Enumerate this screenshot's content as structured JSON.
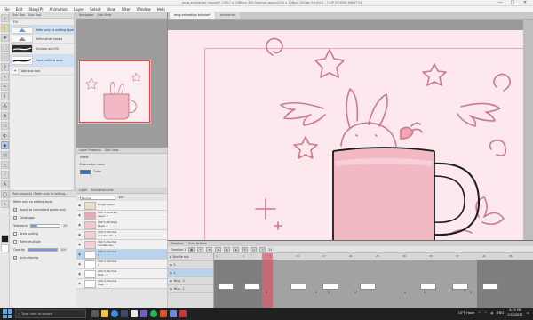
{
  "window": {
    "title": "mug animation tutorial* (1957 x 1080px 300 Normal space(204 x 128px 150dpi 98.4%)) - CLIP STUDIO PAINT EX",
    "controls": [
      "—",
      "□",
      "✕"
    ]
  },
  "menu": [
    "File",
    "Edit",
    "Story(P)",
    "Animation",
    "Layer",
    "Select",
    "View",
    "Filter",
    "Window",
    "Help"
  ],
  "tools": [
    "zoom-icon",
    "hand-icon",
    "move-icon",
    "select-icon",
    "lasso-icon",
    "eyedropper-icon",
    "pen-icon",
    "pencil-icon",
    "brush-icon",
    "airbrush-icon",
    "decoration-icon",
    "eraser-icon",
    "blend-icon",
    "fill-icon",
    "gradient-icon",
    "figure-icon",
    "ruler-icon",
    "text-icon",
    "balloon-icon",
    "correct-line-icon"
  ],
  "subtool": {
    "tabs": [
      "Sub Tool",
      "Sub Tool"
    ],
    "header": "Fill",
    "items": [
      {
        "label": "Refer only to editing layer",
        "selected": true
      },
      {
        "label": "Refer other layers",
        "selected": false
      },
      {
        "label": "Enclose and fill",
        "selected": false
      },
      {
        "label": "Paint unfilled area",
        "selected": false
      },
      {
        "label": "Add sub tool",
        "selected": false
      }
    ]
  },
  "toolprop": {
    "header": "Tool property (Refer only to editing...",
    "title": "Refer only to editing layer",
    "rows": [
      {
        "label": "Apply to connected pixels only",
        "checked": true
      },
      {
        "label": "Close gap",
        "checked": true
      },
      {
        "label": "Tolerance",
        "value": "20"
      },
      {
        "label": "Area scaling",
        "checked": false
      },
      {
        "label": "Refer multiple",
        "checked": false
      },
      {
        "label": "Opacity",
        "value": "100"
      },
      {
        "label": "Anti-aliasing",
        "checked": true
      }
    ],
    "tolerance_level": 0.2,
    "opacity_level": 1.0
  },
  "navigator": {
    "tabs": [
      "Navigator",
      "Sub View"
    ]
  },
  "layerprop": {
    "tabs": [
      "Layer Property",
      "Sub View"
    ],
    "effect_label": "Effect",
    "expression_label": "Expression color",
    "expression_value": "Color"
  },
  "layers": {
    "tabs": [
      "Layer",
      "Animation cels"
    ],
    "blend": "Normal",
    "opacity": "100",
    "rows": [
      {
        "name": "Rough paper",
        "sub": "",
        "selected": false,
        "folder": false
      },
      {
        "name": "100 % Overlay",
        "sub": "Layer 3",
        "selected": false,
        "folder": false
      },
      {
        "name": "100 % Multiply",
        "sub": "Layer 2",
        "selected": false,
        "folder": false
      },
      {
        "name": "100 % Normal",
        "sub": "doodles etc. 2",
        "selected": false,
        "folder": true
      },
      {
        "name": "100 % Normal",
        "sub": "doodles etc.",
        "selected": false,
        "folder": true
      },
      {
        "name": "100 % Normal",
        "sub": "1",
        "selected": true,
        "folder": false
      },
      {
        "name": "100 % Normal",
        "sub": "1",
        "selected": false,
        "folder": false
      },
      {
        "name": "100 % Normal",
        "sub": "Mug - 2",
        "selected": false,
        "folder": false
      },
      {
        "name": "100 % Normal",
        "sub": "Mug - 1",
        "selected": false,
        "folder": false
      }
    ]
  },
  "doctabs": [
    {
      "label": "mug animation tutorial*",
      "active": true
    },
    {
      "label": "animation",
      "active": false
    }
  ],
  "timeline": {
    "tabs": [
      "Timeline",
      "Auto Actions"
    ],
    "name": "Timeline 1",
    "frame_count": "24",
    "tracks": [
      {
        "label": "Bunfile mix",
        "selected": false
      },
      {
        "label": "1",
        "selected": false
      },
      {
        "label": "1",
        "selected": true
      },
      {
        "label": "Mug - 2",
        "selected": false
      },
      {
        "label": "Mug - 1",
        "selected": false
      }
    ],
    "ruler": [
      "1",
      "5",
      "9",
      "13",
      "17",
      "21",
      "25",
      "29",
      "33",
      "37",
      "41",
      "45"
    ],
    "cell_numbers": [
      "8",
      "9",
      "2",
      "5",
      "8",
      "9",
      "2"
    ]
  },
  "taskbar": {
    "search_placeholder": "Type here to search",
    "weather": "10°F Haze",
    "language": "ENG",
    "time": "4:15 PM",
    "date": "2/22/2022"
  },
  "colors": {
    "canvas": "#fce8ed",
    "accent": "#b9d3ef",
    "playhead": "#e23c50",
    "line_art": "#c97b8e"
  }
}
